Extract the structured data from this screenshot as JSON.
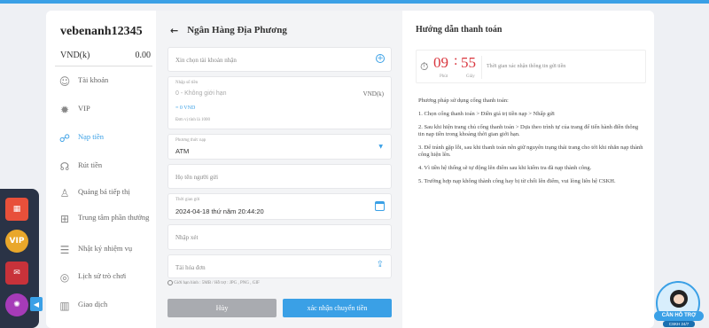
{
  "sidebar": {
    "username": "vebenanh12345",
    "currency": "VND(k)",
    "balance": "0.00",
    "items": [
      {
        "label": "Tài khoản",
        "icon": "user-icon"
      },
      {
        "label": "VIP",
        "icon": "vip-gear-icon"
      },
      {
        "label": "Nạp tiền",
        "icon": "deposit-icon"
      },
      {
        "label": "Rút tiền",
        "icon": "withdraw-icon"
      },
      {
        "label": "Quảng bá tiếp thị",
        "icon": "promo-icon"
      },
      {
        "label": "Trung tâm phần thưởng",
        "icon": "gift-icon"
      },
      {
        "label": "Nhật ký nhiệm vụ",
        "icon": "task-log-icon"
      },
      {
        "label": "Lịch sử trò chơi",
        "icon": "game-history-icon"
      },
      {
        "label": "Giao dịch",
        "icon": "transaction-icon"
      }
    ]
  },
  "form": {
    "title": "Ngân Hàng Địa Phương",
    "select_account_placeholder": "Xin chọn tài khoản nhận",
    "amount_label": "Nhập số tiền",
    "amount_placeholder": "0 - Không giới hạn",
    "amount_unit": "VND(k)",
    "amount_converted": "= 0 VND",
    "amount_note": "Đơn vị tính là 1000",
    "method_label": "Phương thức nạp",
    "method_value": "ATM",
    "sender_placeholder": "Họ tên người gửi",
    "time_label": "Thời gian gửi",
    "time_value": "2024-04-18 thứ năm 20:44:20",
    "note_placeholder": "Nhập xét",
    "upload_placeholder": "Tải hóa đơn",
    "upload_note": "Giới hạn hình : 5MB / Hỗ trợ : JPG , PNG , GIF",
    "cancel_label": "Hủy",
    "confirm_label": "xác nhận chuyển tiền"
  },
  "guide": {
    "title": "Hướng dẫn thanh toán",
    "timer_min": "09",
    "timer_sec": "55",
    "min_label": "Phút",
    "sec_label": "Giây",
    "timer_desc": "Thời gian xác nhận thông tin gửi tiền",
    "steps": [
      "Phương pháp sử dụng cổng thanh toán:",
      "1. Chọn cổng thanh toán > Điền giá trị tiền nạp > Nhấp gửi",
      "2. Sau khi hiện trang chủ cổng thanh toán > Dựa theo trình tự của trang để tiến hành điền thông tin nạp tiền trong khoảng thời gian giới hạn.",
      "3. Để tránh gặp lỗi, sau khi thanh toán nên giữ nguyên trạng thái trang cho tới khi nhắn nạp thành công hiện lên.",
      "4. Vì tiền hệ thống sẽ tự động lên điểm sau khi kiểm tra đã nạp thành công.",
      "5. Trường hợp nạp không thành công hay bị từ chối lên điểm, vui lòng liên hệ CSKH."
    ]
  },
  "support": {
    "label": "CẦN HỖ TRỢ",
    "sub": "CSKH 24/7"
  },
  "colors": {
    "accent": "#3aa0e6",
    "timer_red": "#d9363e",
    "cancel_gray": "#a9abb0"
  }
}
